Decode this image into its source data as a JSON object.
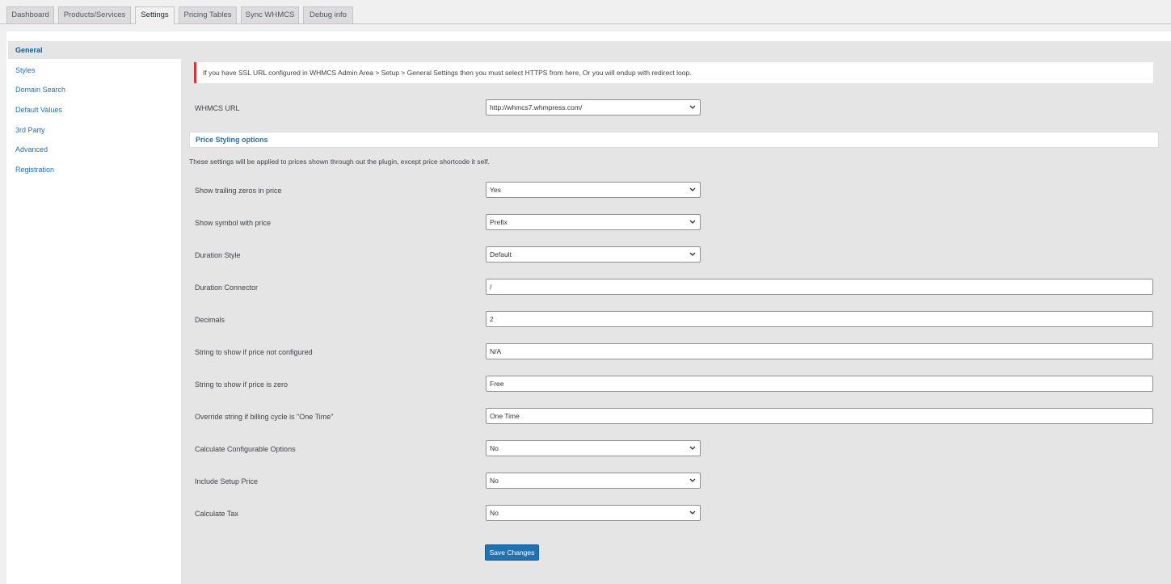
{
  "tabs": [
    {
      "label": "Dashboard",
      "active": false
    },
    {
      "label": "Products/Services",
      "active": false
    },
    {
      "label": "Settings",
      "active": true
    },
    {
      "label": "Pricing Tables",
      "active": false
    },
    {
      "label": "Sync WHMCS",
      "active": false
    },
    {
      "label": "Debug info",
      "active": false
    }
  ],
  "sidebar": {
    "items": [
      {
        "label": "General",
        "active": true
      },
      {
        "label": "Styles"
      },
      {
        "label": "Domain Search"
      },
      {
        "label": "Default Values"
      },
      {
        "label": "3rd Party"
      },
      {
        "label": "Advanced"
      },
      {
        "label": "Registration"
      }
    ]
  },
  "notice": "If you have SSL URL configured in WHMCS Admin Area > Setup > General Settings then you must select HTTPS from here, Or you will endup with redirect loop.",
  "whmcs_url": {
    "label": "WHMCS URL",
    "value": "http://whmcs7.whmpress.com/"
  },
  "price_styling": {
    "title": "Price Styling options",
    "description": "These settings will be applied to prices shown through out the plugin, except price shortcode it self.",
    "fields": [
      {
        "label": "Show trailing zeros in price",
        "value": "Yes"
      },
      {
        "label": "Show symbol with price",
        "value": "Prefix"
      },
      {
        "label": "Duration Style",
        "value": "Default"
      },
      {
        "label": "Duration Connector",
        "value": "/"
      },
      {
        "label": "Decimals",
        "value": "2"
      },
      {
        "label": "String to show if price not configured",
        "value": "N/A"
      },
      {
        "label": "String to show if price is zero",
        "value": "Free"
      },
      {
        "label": "Override string if billing cycle is \"One Time\"",
        "value": "One Time"
      },
      {
        "label": "Calculate Configurable Options",
        "value": "No"
      },
      {
        "label": "Include Setup Price",
        "value": "No"
      },
      {
        "label": "Calculate Tax",
        "value": "No"
      }
    ]
  },
  "save_label": "Save Changes",
  "colors": {
    "accent": "#2271b1",
    "notice_border": "#d63638",
    "content_bg": "#e5e5e5"
  }
}
